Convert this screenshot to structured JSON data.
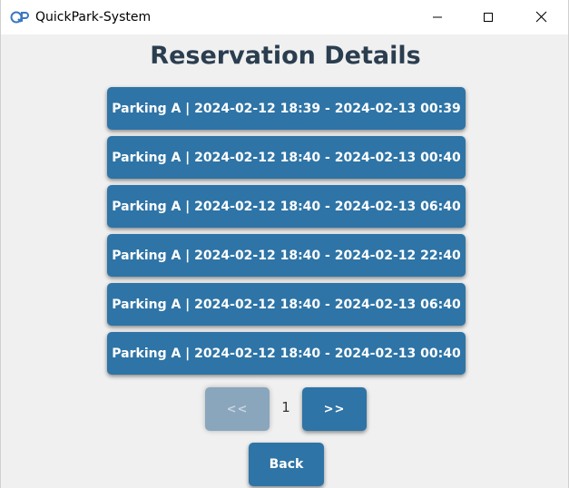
{
  "window": {
    "title": "QuickPark-System",
    "icon": "quickpark-logo-icon",
    "controls": [
      "minimize-icon",
      "maximize-icon",
      "close-icon"
    ]
  },
  "page": {
    "title": "Reservation Details"
  },
  "reservations": [
    "Parking A | 2024-02-12 18:39 - 2024-02-13 00:39",
    "Parking A | 2024-02-12 18:40 - 2024-02-13 00:40",
    "Parking A | 2024-02-12 18:40 - 2024-02-13 06:40",
    "Parking A | 2024-02-12 18:40 - 2024-02-12 22:40",
    "Parking A | 2024-02-12 18:40 - 2024-02-13 06:40",
    "Parking A | 2024-02-12 18:40 - 2024-02-13 00:40"
  ],
  "pagination": {
    "prev_label": "<<",
    "next_label": ">>",
    "current_page": "1",
    "prev_disabled": true
  },
  "back_label": "Back",
  "colors": {
    "button": "#2e74a6",
    "button_disabled": "#8aa6bd",
    "title": "#2b3e50",
    "background": "#f0f0f0"
  }
}
